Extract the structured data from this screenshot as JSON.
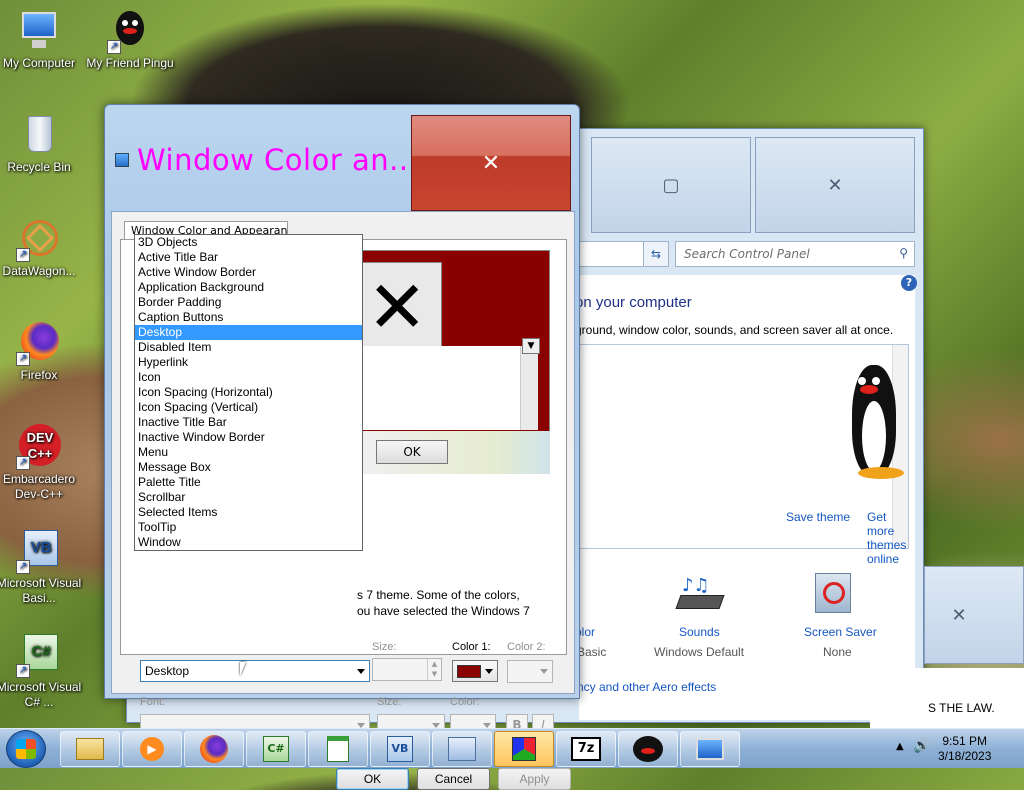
{
  "desktop": {
    "icons": [
      {
        "label": "My Computer",
        "icon": "computer-icon"
      },
      {
        "label": "My Friend Pingu",
        "icon": "penguin-icon"
      },
      {
        "label": "Recycle Bin",
        "icon": "recycle-bin-icon"
      },
      {
        "label": "DataWagon...",
        "icon": "datawagon-icon"
      },
      {
        "label": "Firefox",
        "icon": "firefox-icon"
      },
      {
        "label": "Embarcadero Dev-C++",
        "icon": "devcpp-icon"
      },
      {
        "label": "Microsoft Visual Basi...",
        "icon": "visual-basic-icon"
      },
      {
        "label": "Microsoft Visual C# ...",
        "icon": "visual-csharp-icon"
      }
    ]
  },
  "background_window": {
    "search_placeholder": "Search Control Panel",
    "heading": "on your computer",
    "subheading": "ground, window color, sounds, and screen saver all at once.",
    "save_theme": "Save theme",
    "get_more_themes": "Get more themes online",
    "bottom_items": [
      {
        "title": "olor",
        "sub": "Basic"
      },
      {
        "title": "Sounds",
        "sub": "Windows Default"
      },
      {
        "title": "Screen Saver",
        "sub": "None"
      }
    ],
    "aero_link": "ncy and other Aero effects",
    "footer_text": "S THE LAW."
  },
  "dialog": {
    "title": "Window Color an...",
    "tab_label": "Window Color and Appearance",
    "preview_ok": "OK",
    "description_line1": "s 7 theme.  Some of the colors,",
    "description_line2": "ou have selected the Windows 7",
    "item_value": "Desktop",
    "size_label": "Size:",
    "color1_label": "Color 1:",
    "color2_label": "Color 2:",
    "font_label": "Font:",
    "font_size_label": "Size:",
    "font_color_label": "Color:",
    "bold_label": "B",
    "italic_label": "I",
    "ok": "OK",
    "cancel": "Cancel",
    "apply": "Apply",
    "color1_value": "#8a0000",
    "item_options": [
      "3D Objects",
      "Active Title Bar",
      "Active Window Border",
      "Application Background",
      "Border Padding",
      "Caption Buttons",
      "Desktop",
      "Disabled Item",
      "Hyperlink",
      "Icon",
      "Icon Spacing (Horizontal)",
      "Icon Spacing (Vertical)",
      "Inactive Title Bar",
      "Inactive Window Border",
      "Menu",
      "Message Box",
      "Palette Title",
      "Scrollbar",
      "Selected Items",
      "ToolTip",
      "Window"
    ],
    "selected_option": "Desktop"
  },
  "taskbar": {
    "time": "9:51 PM",
    "date": "3/18/2023"
  }
}
